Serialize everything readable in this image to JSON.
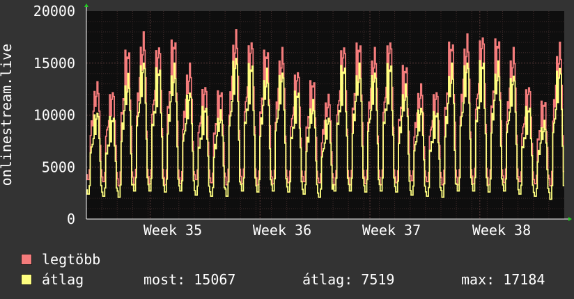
{
  "chart_data": {
    "type": "line",
    "ylabel": "onlinestream.live",
    "ylim": [
      0,
      20000
    ],
    "yticks": [
      0,
      5000,
      10000,
      15000,
      20000
    ],
    "ytick_labels": [
      "0",
      "5000",
      "10000",
      "15000",
      "20000"
    ],
    "xticks": [
      "Week 35",
      "Week 36",
      "Week 37",
      "Week 38"
    ],
    "grid": true,
    "series": [
      {
        "name": "legtöbb",
        "color": "#f47c7c",
        "daily_peaks": [
          13200,
          12500,
          16500,
          18000,
          17000,
          17500,
          15000,
          13000,
          12500,
          18200,
          17500,
          16500,
          16500,
          14500,
          13500,
          12000,
          17000,
          17200,
          16500,
          17500,
          15000,
          13000,
          12500,
          17300,
          17800,
          18000,
          17600,
          16500,
          13000,
          11500,
          17000
        ],
        "daily_lows": [
          3800,
          3600,
          3200,
          3300,
          3400,
          3300,
          3400,
          3800,
          3500,
          3300,
          3400,
          3300,
          3400,
          3500,
          3600,
          3500,
          3300,
          3300,
          3400,
          3300,
          3500,
          3700,
          3600,
          3300,
          3300,
          3400,
          3300,
          3500,
          3600,
          3400,
          3200
        ]
      },
      {
        "name": "átlag",
        "color": "#ffff80",
        "daily_peaks": [
          10500,
          10000,
          14000,
          15500,
          14800,
          15000,
          12500,
          11000,
          10500,
          16000,
          15200,
          14500,
          14500,
          12500,
          11500,
          10000,
          15000,
          15000,
          14500,
          15200,
          13000,
          11000,
          10500,
          15000,
          15500,
          15500,
          15200,
          14200,
          11000,
          9500,
          15000
        ],
        "daily_lows": [
          2400,
          2200,
          2100,
          2700,
          2700,
          2600,
          2700,
          2300,
          2200,
          2200,
          2700,
          2600,
          2700,
          2600,
          2400,
          2100,
          2700,
          2700,
          2600,
          2700,
          2600,
          2300,
          2200,
          2100,
          2700,
          2700,
          2600,
          2700,
          2400,
          2200,
          1900
        ]
      }
    ]
  },
  "legend": [
    {
      "label": "legtöbb",
      "color": "#f47c7c"
    },
    {
      "label": "átlag",
      "color": "#ffff80"
    }
  ],
  "stats": {
    "current": "most: 15067",
    "average": "átlag: 7519",
    "max": "max: 17184"
  }
}
